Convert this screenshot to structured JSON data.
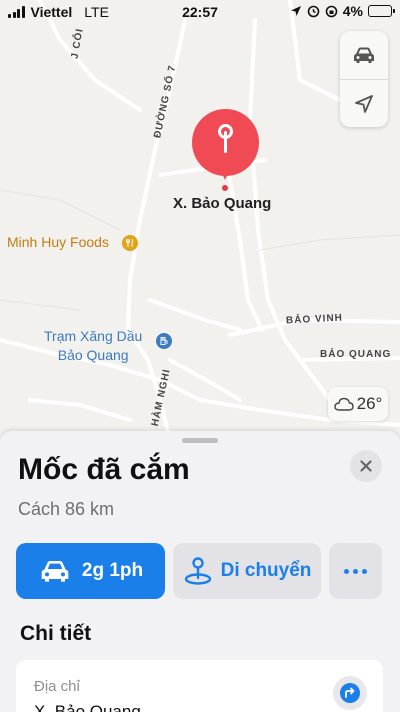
{
  "status_bar": {
    "carrier": "Viettel",
    "network": "LTE",
    "time": "22:57",
    "battery": "4%",
    "battery_level": 0.04
  },
  "map": {
    "place_label": "X. Bảo Quang",
    "roads": [
      "ĐƯỜNG SỐ 7",
      "BẢO VINH",
      "BẢO QUANG",
      "HÀM NGHI",
      "J CÔI"
    ],
    "pois": [
      {
        "name": "Minh Huy Foods",
        "icon": "fork-knife-icon",
        "color": "#c77b10"
      },
      {
        "name_line1": "Trạm Xăng Dầu",
        "name_line2": "Bảo Quang",
        "icon": "fuel-icon",
        "color": "#3b7bbf"
      }
    ],
    "weather": {
      "icon": "cloud-icon",
      "temperature": "26°"
    },
    "pin_color": "#f04a55"
  },
  "sheet": {
    "title": "Mốc đã cắm",
    "distance": "Cách 86 km",
    "actions": {
      "drive_label": "2g 1ph",
      "move_label": "Di chuyển"
    },
    "section_title": "Chi tiết",
    "address": {
      "label": "Địa chỉ",
      "value": "X. Bảo Quang"
    },
    "accent": "#1a7fe8"
  }
}
